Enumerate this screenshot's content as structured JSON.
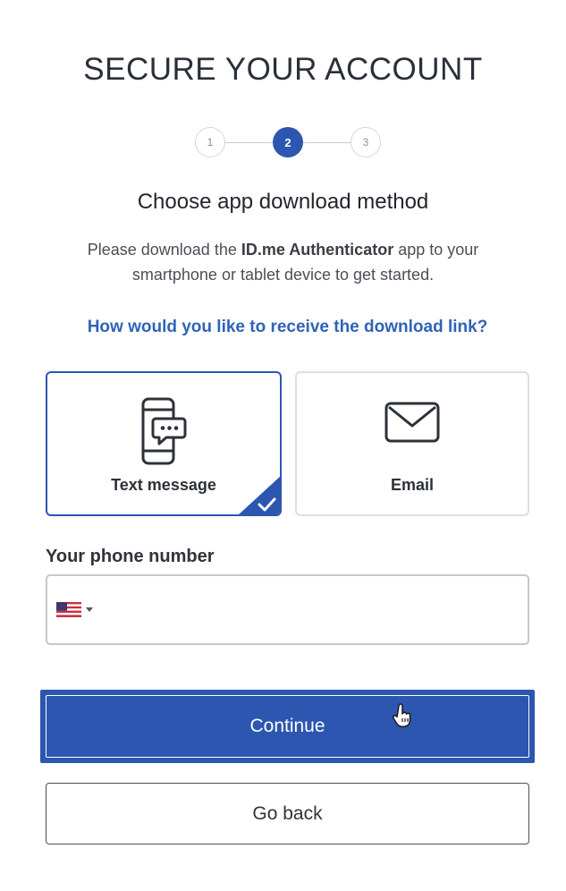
{
  "page": {
    "title": "SECURE YOUR ACCOUNT"
  },
  "stepper": {
    "steps": [
      "1",
      "2",
      "3"
    ],
    "current_step": 2
  },
  "content": {
    "subtitle": "Choose app download method",
    "description_prefix": "Please download the ",
    "description_bold": "ID.me Authenticator",
    "description_suffix": " app to your smartphone or tablet device to get started.",
    "question": "How would you like to receive the download link?"
  },
  "options": {
    "text_message": {
      "label": "Text message",
      "icon": "phone-chat-icon",
      "selected": true
    },
    "email": {
      "label": "Email",
      "icon": "envelope-icon",
      "selected": false
    }
  },
  "phone": {
    "label": "Your phone number",
    "country_flag": "us-flag-icon",
    "value": ""
  },
  "buttons": {
    "continue_label": "Continue",
    "back_label": "Go back"
  },
  "colors": {
    "primary": "#2c56b0",
    "link": "#2f63b8",
    "border": "#c5c8cc"
  }
}
